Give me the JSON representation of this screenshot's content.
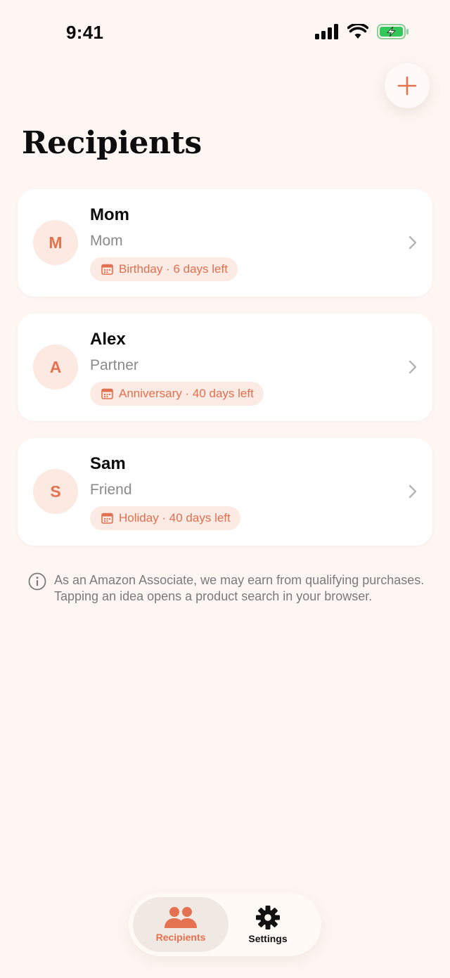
{
  "status_bar": {
    "time": "9:41"
  },
  "header": {
    "title": "Recipients",
    "add_icon": "plus-icon"
  },
  "recipients": [
    {
      "initial": "M",
      "name": "Mom",
      "relation": "Mom",
      "event": "Birthday · 6 days left"
    },
    {
      "initial": "A",
      "name": "Alex",
      "relation": "Partner",
      "event": "Anniversary · 40 days left"
    },
    {
      "initial": "S",
      "name": "Sam",
      "relation": "Friend",
      "event": "Holiday · 40 days left"
    }
  ],
  "disclaimer": {
    "text": "As an Amazon Associate, we may earn from qualifying purchases. Tapping an idea opens a product search in your browser."
  },
  "tab_bar": {
    "tabs": [
      {
        "label": "Recipients",
        "icon": "people-icon",
        "active": true
      },
      {
        "label": "Settings",
        "icon": "gear-icon",
        "active": false
      }
    ]
  },
  "colors": {
    "accent": "#e4714f",
    "background": "#fdf6f2",
    "avatar_bg": "#fbe9e2",
    "badge_bg": "#fcebe4",
    "battery": "#34c759"
  }
}
